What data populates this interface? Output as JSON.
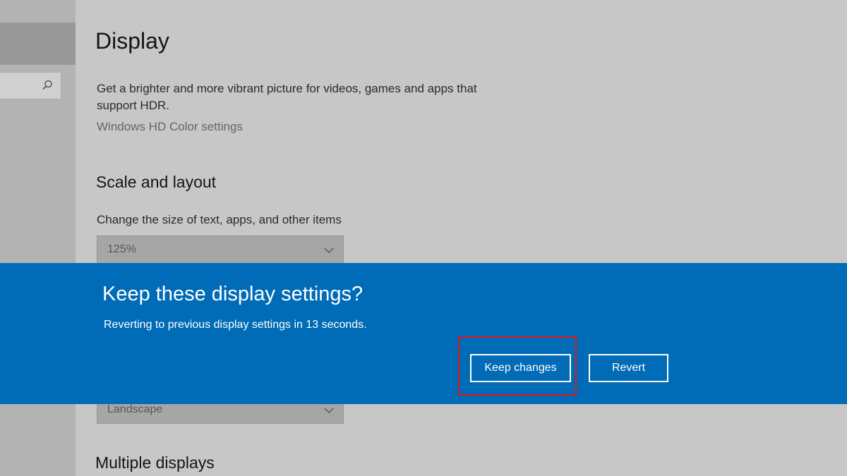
{
  "page": {
    "title": "Display",
    "hdr_description": "Get a brighter and more vibrant picture for videos, games and apps that support HDR.",
    "hdr_link": "Windows HD Color settings",
    "scale_section_title": "Scale and layout",
    "scale_label": "Change the size of text, apps, and other items",
    "scale_value": "125%",
    "orientation_value": "Landscape",
    "multiple_displays_title": "Multiple displays"
  },
  "dialog": {
    "title": "Keep these display settings?",
    "message": "Reverting to previous display settings in 13 seconds.",
    "keep_label": "Keep changes",
    "revert_label": "Revert"
  },
  "colors": {
    "banner": "#006bb6",
    "highlight": "#e8131b"
  },
  "icons": {
    "search": "search-icon",
    "chevron": "chevron-down-icon"
  }
}
